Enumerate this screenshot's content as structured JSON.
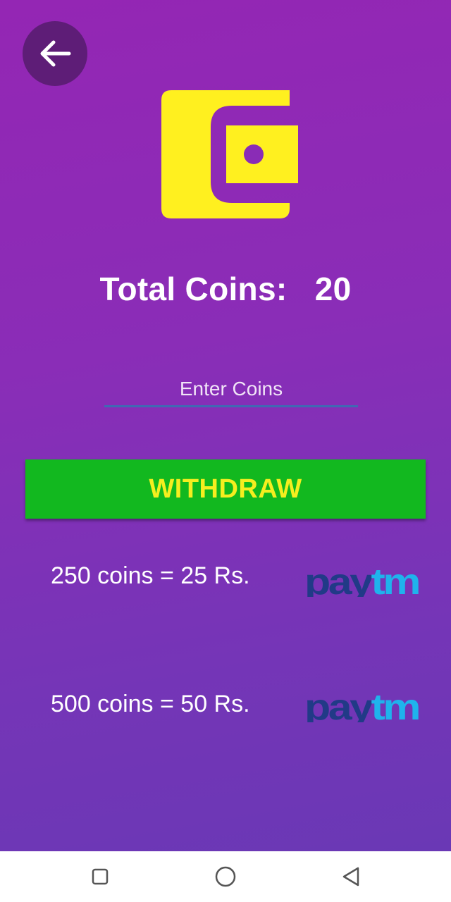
{
  "header": {
    "back_icon": "arrow-left-icon"
  },
  "wallet": {
    "icon": "wallet-icon",
    "color": "#fff01f"
  },
  "coins": {
    "label": "Total Coins:",
    "value": "20"
  },
  "input": {
    "placeholder": "Enter Coins",
    "value": ""
  },
  "withdraw": {
    "label": "WITHDRAW",
    "bg_color": "#12b81f",
    "text_color": "#f5ee1f"
  },
  "rates": [
    {
      "text": "250 coins = 25 Rs.",
      "logo": "Paytm"
    },
    {
      "text": "500 coins = 50 Rs.",
      "logo": "Paytm"
    }
  ],
  "navbar": {
    "recents_icon": "square-icon",
    "home_icon": "circle-icon",
    "back_icon": "triangle-back-icon"
  },
  "colors": {
    "bg_top": "#9426b4",
    "bg_bottom": "#6a38b5",
    "paytm_dark": "#213a87",
    "paytm_light": "#1fb3ec"
  }
}
